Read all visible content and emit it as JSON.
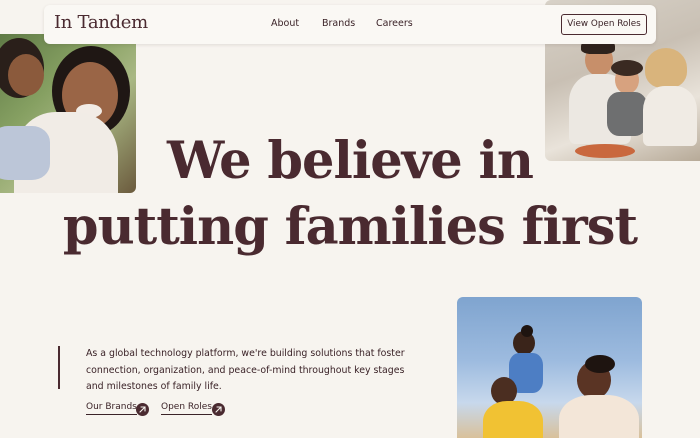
{
  "header": {
    "logo": "In Tandem",
    "nav": {
      "about": "About",
      "brands": "Brands",
      "careers": "Careers"
    },
    "cta": "View Open Roles"
  },
  "hero": {
    "headline_line1": "We believe in",
    "headline_line2": "putting families first"
  },
  "intro": {
    "text": "As a global technology platform, we're building solutions that foster connection, organization, and peace-of-mind throughout key stages and milestones of family life.",
    "links": {
      "brands": "Our Brands",
      "roles": "Open Roles"
    }
  },
  "icons": {
    "link_arrow": "arrow-up-right-icon"
  },
  "colors": {
    "background": "#f7f4ef",
    "primary_text": "#4a2a30",
    "header_bg": "#faf8f4"
  }
}
